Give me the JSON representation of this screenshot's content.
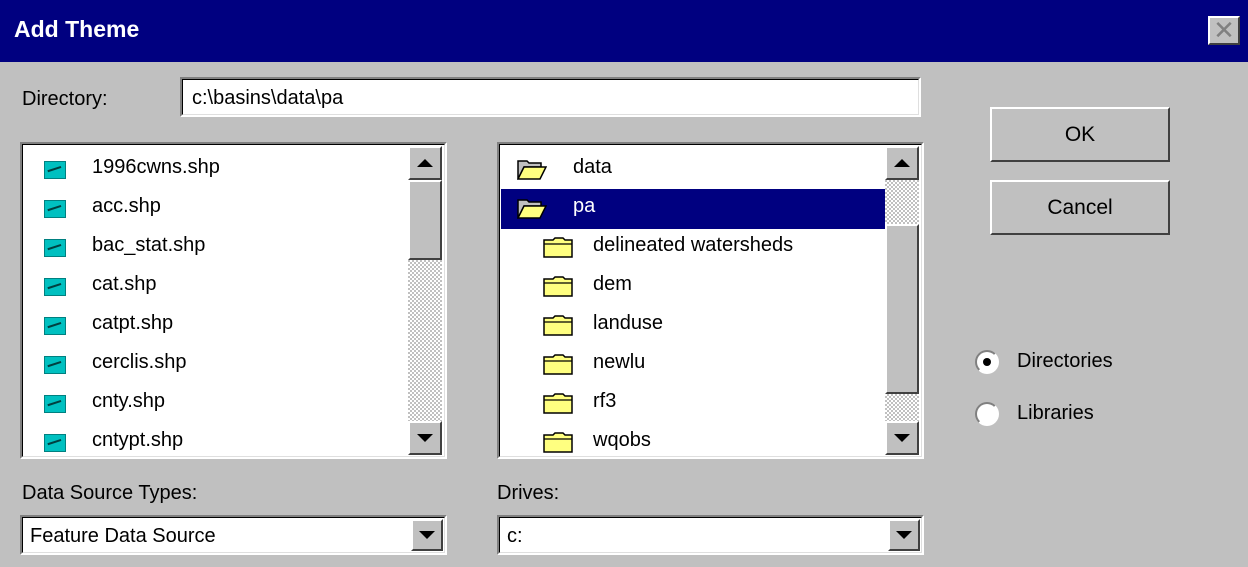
{
  "window": {
    "title": "Add Theme",
    "close_glyph": "✕"
  },
  "directory": {
    "label": "Directory:",
    "value": "c:\\basins\\data\\pa"
  },
  "files": {
    "items": [
      {
        "label": "1996cwns.shp",
        "icon": "shapefile-icon"
      },
      {
        "label": "acc.shp",
        "icon": "shapefile-icon"
      },
      {
        "label": "bac_stat.shp",
        "icon": "shapefile-icon"
      },
      {
        "label": "cat.shp",
        "icon": "shapefile-icon"
      },
      {
        "label": "catpt.shp",
        "icon": "shapefile-icon"
      },
      {
        "label": "cerclis.shp",
        "icon": "shapefile-icon"
      },
      {
        "label": "cnty.shp",
        "icon": "shapefile-icon"
      },
      {
        "label": "cntypt.shp",
        "icon": "shapefile-icon"
      }
    ]
  },
  "directories": {
    "items": [
      {
        "label": "data",
        "icon": "open-folder-icon",
        "selected": false
      },
      {
        "label": "pa",
        "icon": "open-folder-icon",
        "selected": true
      },
      {
        "label": "delineated watersheds",
        "icon": "folder-icon",
        "selected": false
      },
      {
        "label": "dem",
        "icon": "folder-icon",
        "selected": false
      },
      {
        "label": "landuse",
        "icon": "folder-icon",
        "selected": false
      },
      {
        "label": "newlu",
        "icon": "folder-icon",
        "selected": false
      },
      {
        "label": "rf3",
        "icon": "folder-icon",
        "selected": false
      },
      {
        "label": "wqobs",
        "icon": "folder-icon",
        "selected": false
      }
    ]
  },
  "buttons": {
    "ok": "OK",
    "cancel": "Cancel"
  },
  "view_mode": {
    "options": [
      {
        "label": "Directories",
        "checked": true
      },
      {
        "label": "Libraries",
        "checked": false
      }
    ]
  },
  "data_source": {
    "label": "Data Source Types:",
    "value": "Feature Data Source"
  },
  "drives": {
    "label": "Drives:",
    "value": "c:"
  },
  "colors": {
    "title_bar": "#000080",
    "face": "#c0c0c0",
    "selection": "#000080",
    "shapefile_icon": "#00c0c0",
    "folder": "#ffff80"
  }
}
